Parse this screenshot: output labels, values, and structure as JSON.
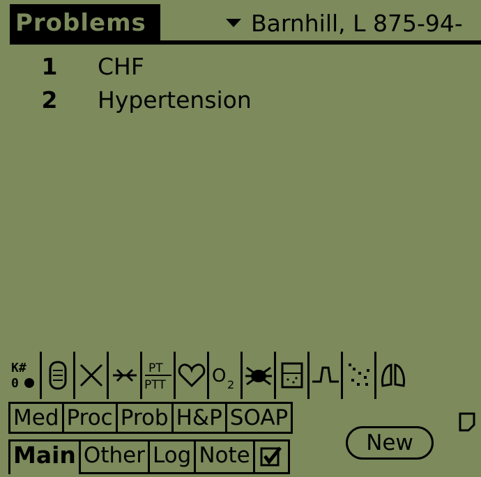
{
  "header": {
    "title": "Problems",
    "patient": "Barnhill, L 875-94-"
  },
  "problems": [
    {
      "num": "1",
      "name": "CHF"
    },
    {
      "num": "2",
      "name": "Hypertension"
    }
  ],
  "icons": [
    {
      "name": "kx-icon",
      "label": "K# 0"
    },
    {
      "name": "iv-bag-icon"
    },
    {
      "name": "x-cross-icon"
    },
    {
      "name": "arrow-converge-icon"
    },
    {
      "name": "pt-ptt-icon",
      "label_top": "PT",
      "label_bottom": "PTT"
    },
    {
      "name": "heart-icon"
    },
    {
      "name": "oxygen-icon",
      "label": "O2"
    },
    {
      "name": "bug-icon"
    },
    {
      "name": "urine-cup-icon"
    },
    {
      "name": "waveform-icon"
    },
    {
      "name": "xray-icon"
    },
    {
      "name": "lungs-icon"
    }
  ],
  "tabs_row1": [
    "Med",
    "Proc",
    "Prob",
    "H&P",
    "SOAP"
  ],
  "tabs_row2": [
    "Main",
    "Other",
    "Log",
    "Note"
  ],
  "active_tab": "Main",
  "new_button": "New"
}
